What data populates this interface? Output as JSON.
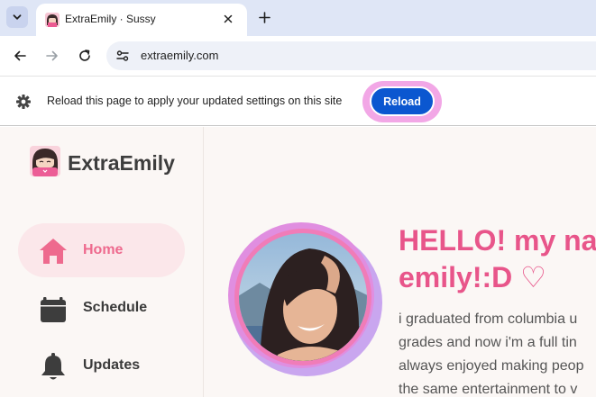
{
  "browser": {
    "tab": {
      "title": "ExtraEmily · Sussy"
    },
    "address": {
      "url": "extraemily.com"
    },
    "infobar": {
      "message": "Reload this page to apply your updated settings on this site",
      "button_label": "Reload"
    },
    "icons": [
      "chevron-down-icon",
      "close-icon",
      "plus-icon",
      "back-arrow-icon",
      "forward-arrow-icon",
      "reload-icon",
      "site-settings-icon",
      "gear-icon"
    ]
  },
  "site": {
    "brand": "ExtraEmily",
    "nav": [
      {
        "label": "Home",
        "icon": "home-icon",
        "active": true
      },
      {
        "label": "Schedule",
        "icon": "calendar-icon",
        "active": false
      },
      {
        "label": "Updates",
        "icon": "bell-icon",
        "active": false
      }
    ],
    "hero": {
      "heading_line1": "HELLO! my nar",
      "heading_line2": "emily!:D ♡",
      "bio_lines": [
        "i graduated from columbia u",
        "grades and now i'm a full tin",
        "always enjoyed making peop",
        "the same entertainment to v"
      ]
    }
  },
  "colors": {
    "accent_pink": "#e8558a",
    "reload_blue": "#0b57d0",
    "active_nav_bg": "#fbe7ea"
  }
}
